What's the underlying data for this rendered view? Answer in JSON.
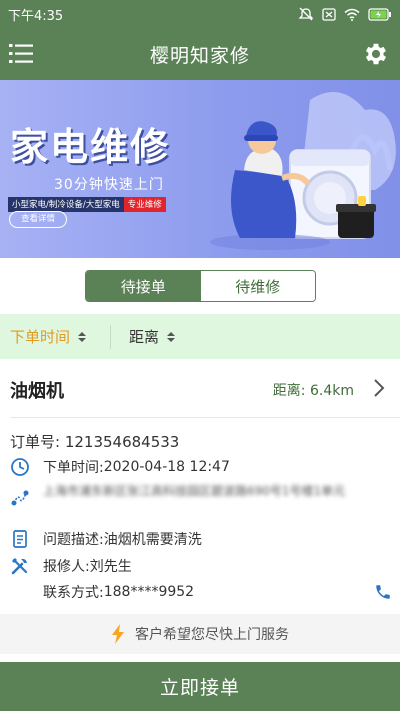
{
  "status_bar": {
    "time": "下午4:35",
    "battery_color": "#7cd44d"
  },
  "app_bar": {
    "title": "樱明知家修",
    "menu_icon": "menu-icon",
    "settings_icon": "gear-icon"
  },
  "banner": {
    "headline": "家电维修",
    "subtitle": "30分钟快速上门",
    "tag_categories": "小型家电/制冷设备/大型家电",
    "tag_highlight": "专业维修",
    "detail_button": "查看详情"
  },
  "tabs": {
    "active": "待接单",
    "inactive": "待维修"
  },
  "sort": {
    "order_time": "下单时间",
    "distance": "距离"
  },
  "order": {
    "appliance": "油烟机",
    "distance": "距离: 6.4km",
    "order_no": "订单号: 121354684533",
    "order_time_label": "下单时间: ",
    "order_time_value": "2020-04-18 12:47",
    "address_blurred": "上海市浦东新区张江高科技园区碧波路690号1号楼1单元",
    "problem_label": "问题描述: ",
    "problem_value": "油烟机需要清洗",
    "reporter_label": "报修人: ",
    "reporter_value": "刘先生",
    "contact_label": "联系方式: ",
    "contact_value": "188****9952",
    "notice": "客户希望您尽快上门服务"
  },
  "accept_button": "立即接单",
  "colors": {
    "primary": "#5b8256",
    "sort_bg": "#dff7df",
    "sort_active": "#e39b20",
    "icon_blue": "#2a76c6",
    "bolt": "#f5a623"
  }
}
